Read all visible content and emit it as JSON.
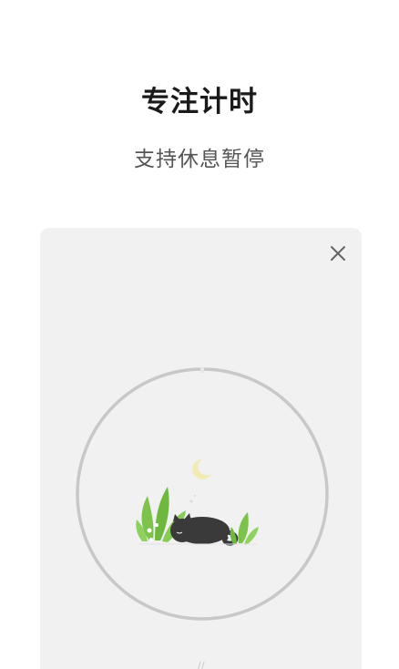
{
  "header": {
    "title": "专注计时",
    "subtitle": "支持休息暂停"
  },
  "card": {
    "close_icon": "close-icon",
    "timer": {
      "progress": 0.0,
      "ring_color": "#c8c8c8",
      "track_color": "#d6d6d6"
    },
    "illustration": "sleeping-cat-with-moon-and-plants",
    "bottom_hint": "// "
  },
  "colors": {
    "plant_green": "#7cc24b",
    "cat_dark": "#3a3a3a",
    "moon_yellow": "#f2ebb6",
    "card_bg": "#f1f1f1"
  }
}
